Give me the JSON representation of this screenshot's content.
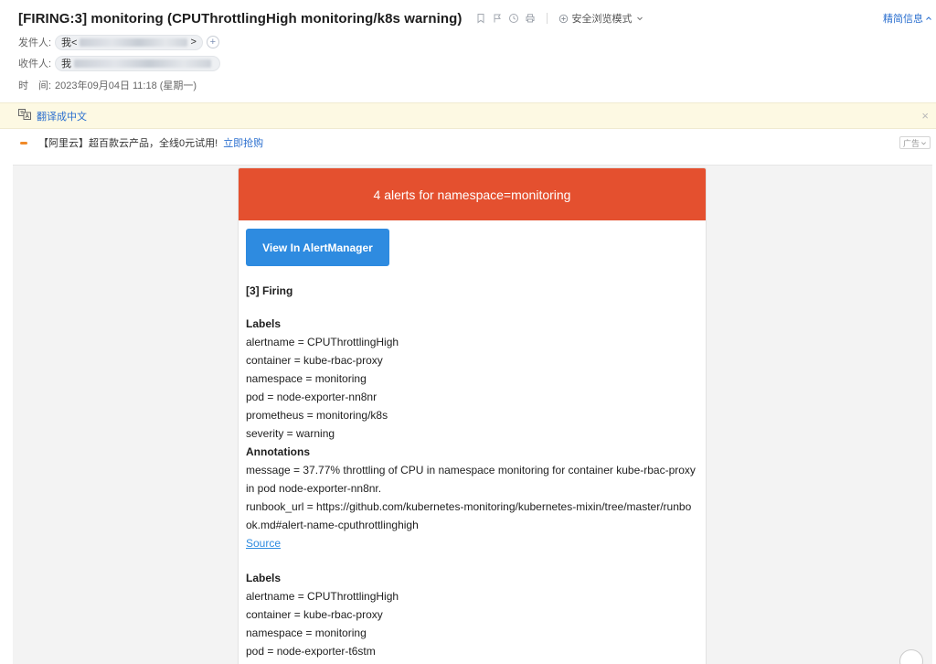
{
  "header": {
    "subject": "[FIRING:3] monitoring (CPUThrottlingHigh monitoring/k8s warning)",
    "safe_mode_label": "安全浏览模式",
    "brief_info_label": "精简信息",
    "sender_label": "发件人:",
    "sender_prefix": "我<",
    "sender_suffix": ">",
    "recipient_label": "收件人:",
    "recipient_prefix": "我",
    "time_label": "时　间:",
    "time_value": "2023年09月04日 11:18 (星期一)"
  },
  "translate_bar": {
    "label": "翻译成中文"
  },
  "ad_bar": {
    "text": "【阿里云】超百款云产品，全线0元试用!",
    "link": "立即抢购",
    "tag": "广告"
  },
  "mail": {
    "banner": "4 alerts for namespace=monitoring",
    "button": "View In AlertManager",
    "firing_title": "[3] Firing",
    "alert1": {
      "labels_title": "Labels",
      "labels": [
        "alertname = CPUThrottlingHigh",
        "container = kube-rbac-proxy",
        "namespace = monitoring",
        "pod = node-exporter-nn8nr",
        "prometheus = monitoring/k8s",
        "severity = warning"
      ],
      "annotations_title": "Annotations",
      "message": "message = 37.77% throttling of CPU in namespace monitoring for container kube-rbac-proxy in pod node-exporter-nn8nr.",
      "runbook": "runbook_url = https://github.com/kubernetes-monitoring/kubernetes-mixin/tree/master/runbook.md#alert-name-cputhrottlinghigh",
      "source": "Source"
    },
    "alert2": {
      "labels_title": "Labels",
      "labels": [
        "alertname = CPUThrottlingHigh",
        "container = kube-rbac-proxy",
        "namespace = monitoring",
        "pod = node-exporter-t6stm"
      ]
    }
  },
  "colors": {
    "banner": "#e4502f",
    "button": "#2e8be0",
    "link": "#2b6fcf",
    "translate_bg": "#fdf9e3"
  }
}
